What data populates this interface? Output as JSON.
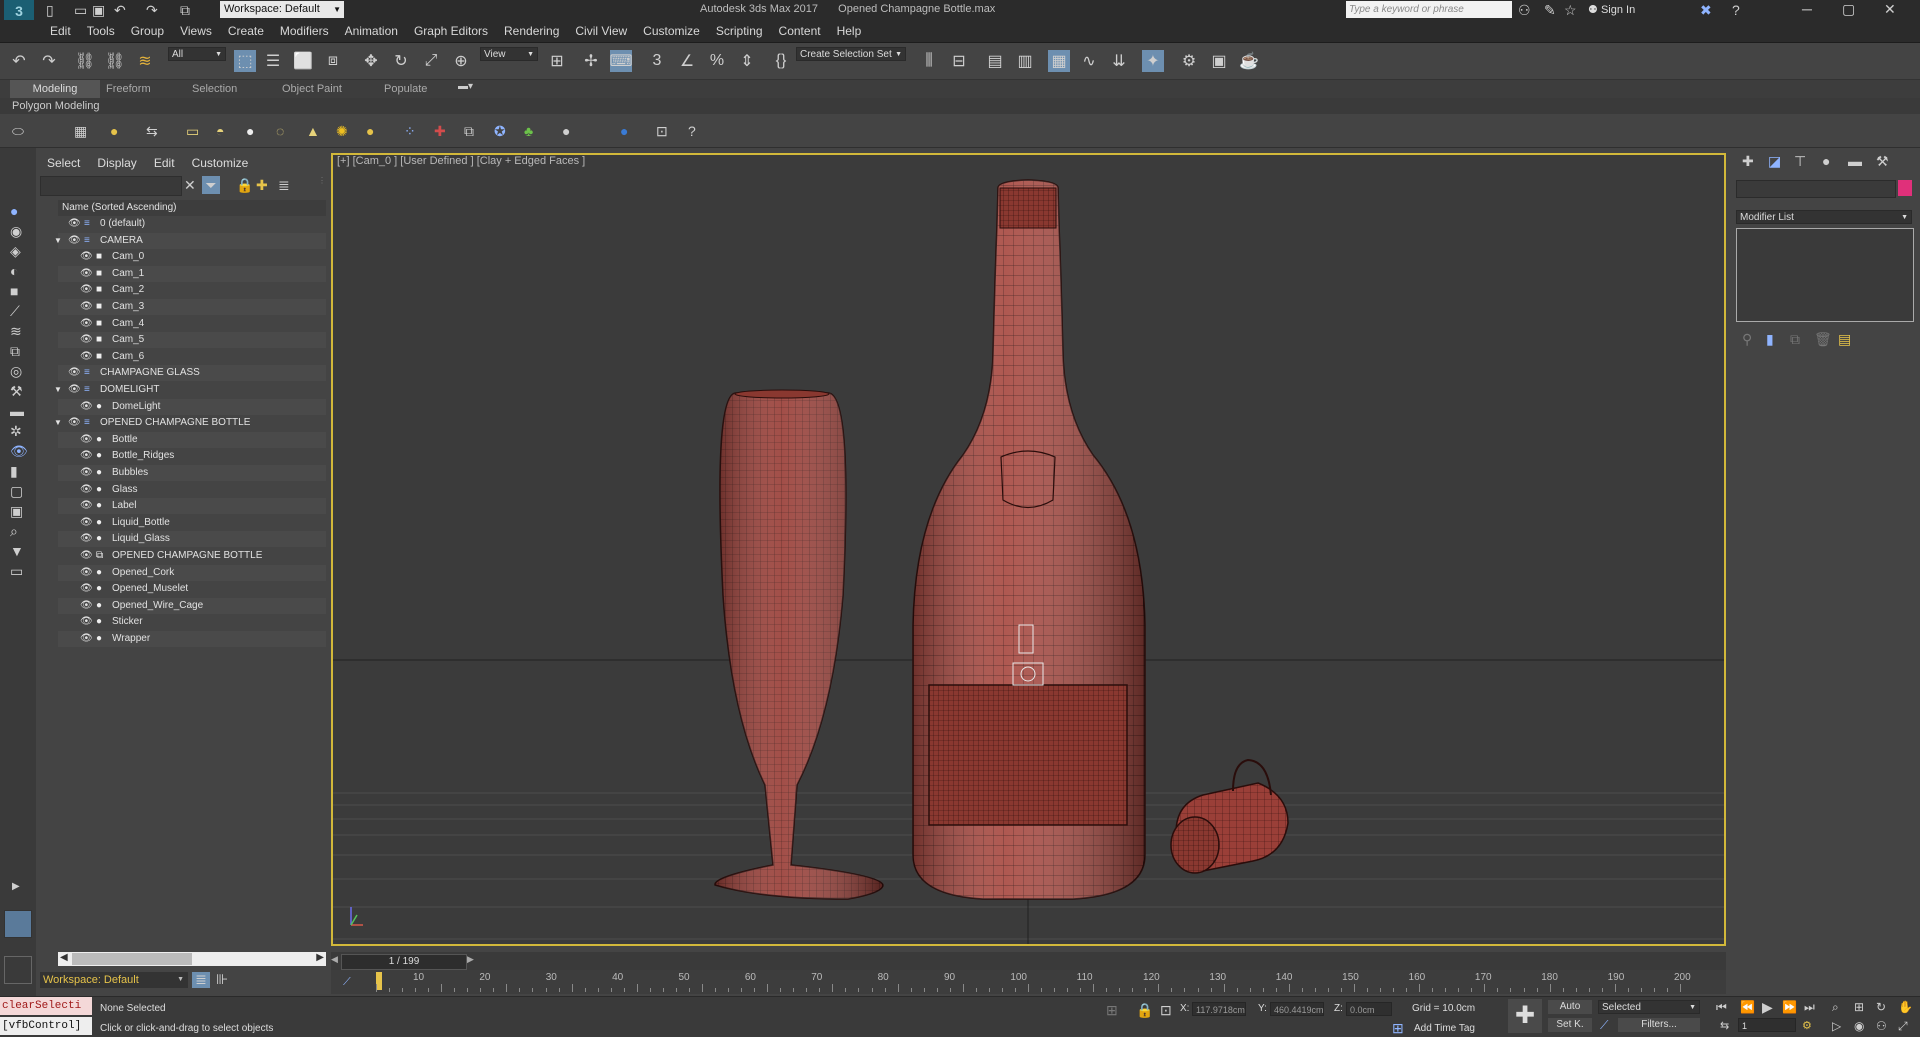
{
  "title_bar": {
    "workspace_label": "Workspace: Default",
    "app_title": "Autodesk 3ds Max 2017",
    "file_name": "Opened Champagne Bottle.max",
    "search_placeholder": "Type a keyword or phrase",
    "sign_in": "Sign In"
  },
  "menu": [
    "Edit",
    "Tools",
    "Group",
    "Views",
    "Create",
    "Modifiers",
    "Animation",
    "Graph Editors",
    "Rendering",
    "Civil View",
    "Customize",
    "Scripting",
    "Content",
    "Help"
  ],
  "toolbar": {
    "filter_value": "All",
    "view_value": "View",
    "selection_set_value": "Create Selection Set"
  },
  "ribbon": {
    "tabs": [
      "Modeling",
      "Freeform",
      "Selection",
      "Object Paint",
      "Populate"
    ],
    "sub_label": "Polygon Modeling"
  },
  "scene_explorer": {
    "menu": [
      "Select",
      "Display",
      "Edit",
      "Customize"
    ],
    "column_header": "Name (Sorted Ascending)",
    "rows": [
      {
        "label": "0 (default)",
        "level": 1,
        "type": "layer"
      },
      {
        "label": "CAMERA",
        "level": 1,
        "type": "layer-open"
      },
      {
        "label": "Cam_0",
        "level": 2,
        "type": "camera"
      },
      {
        "label": "Cam_1",
        "level": 2,
        "type": "camera"
      },
      {
        "label": "Cam_2",
        "level": 2,
        "type": "camera"
      },
      {
        "label": "Cam_3",
        "level": 2,
        "type": "camera"
      },
      {
        "label": "Cam_4",
        "level": 2,
        "type": "camera"
      },
      {
        "label": "Cam_5",
        "level": 2,
        "type": "camera"
      },
      {
        "label": "Cam_6",
        "level": 2,
        "type": "camera"
      },
      {
        "label": "CHAMPAGNE GLASS",
        "level": 1,
        "type": "layer"
      },
      {
        "label": "DOMELIGHT",
        "level": 1,
        "type": "layer-open"
      },
      {
        "label": "DomeLight",
        "level": 2,
        "type": "light"
      },
      {
        "label": "OPENED CHAMPAGNE BOTTLE",
        "level": 1,
        "type": "layer-open"
      },
      {
        "label": "Bottle",
        "level": 2,
        "type": "object"
      },
      {
        "label": "Bottle_Ridges",
        "level": 2,
        "type": "object"
      },
      {
        "label": "Bubbles",
        "level": 2,
        "type": "object"
      },
      {
        "label": "Glass",
        "level": 2,
        "type": "object"
      },
      {
        "label": "Label",
        "level": 2,
        "type": "object"
      },
      {
        "label": "Liquid_Bottle",
        "level": 2,
        "type": "object"
      },
      {
        "label": "Liquid_Glass",
        "level": 2,
        "type": "object"
      },
      {
        "label": "OPENED CHAMPAGNE BOTTLE",
        "level": 2,
        "type": "group"
      },
      {
        "label": "Opened_Cork",
        "level": 2,
        "type": "object"
      },
      {
        "label": "Opened_Muselet",
        "level": 2,
        "type": "object"
      },
      {
        "label": "Opened_Wire_Cage",
        "level": 2,
        "type": "object"
      },
      {
        "label": "Sticker",
        "level": 2,
        "type": "object"
      },
      {
        "label": "Wrapper",
        "level": 2,
        "type": "object"
      }
    ],
    "workspace": "Workspace: Default"
  },
  "viewport": {
    "label": "[+] [Cam_0 ] [User Defined ] [Clay + Edged Faces ]"
  },
  "right_panel": {
    "modifier_list": "Modifier List"
  },
  "timeline": {
    "frame_label": "1 / 199",
    "ticks": [
      "10",
      "20",
      "30",
      "40",
      "50",
      "60",
      "70",
      "80",
      "90",
      "100",
      "110",
      "120",
      "130",
      "140",
      "150",
      "160",
      "170",
      "180",
      "190",
      "200"
    ]
  },
  "status": {
    "maxscript_1": "clearSelecti",
    "maxscript_2": "[vfbControl]",
    "selection": "None Selected",
    "prompt": "Click or click-and-drag to select objects",
    "x_label": "X:",
    "x_value": "117.9718cm",
    "y_label": "Y:",
    "y_value": "460.4419cm",
    "z_label": "Z:",
    "z_value": "0.0cm",
    "grid": "Grid = 10.0cm",
    "add_time_tag": "Add Time Tag",
    "auto": "Auto",
    "set_key": "Set K.",
    "selected_dropdown": "Selected",
    "filters": "Filters...",
    "frame_field": "1"
  },
  "colors": {
    "viewport_border": "#d2b83a",
    "model_fill": "#a84a42",
    "wire": "#3a1512",
    "color_swatch": "#e0307a"
  }
}
